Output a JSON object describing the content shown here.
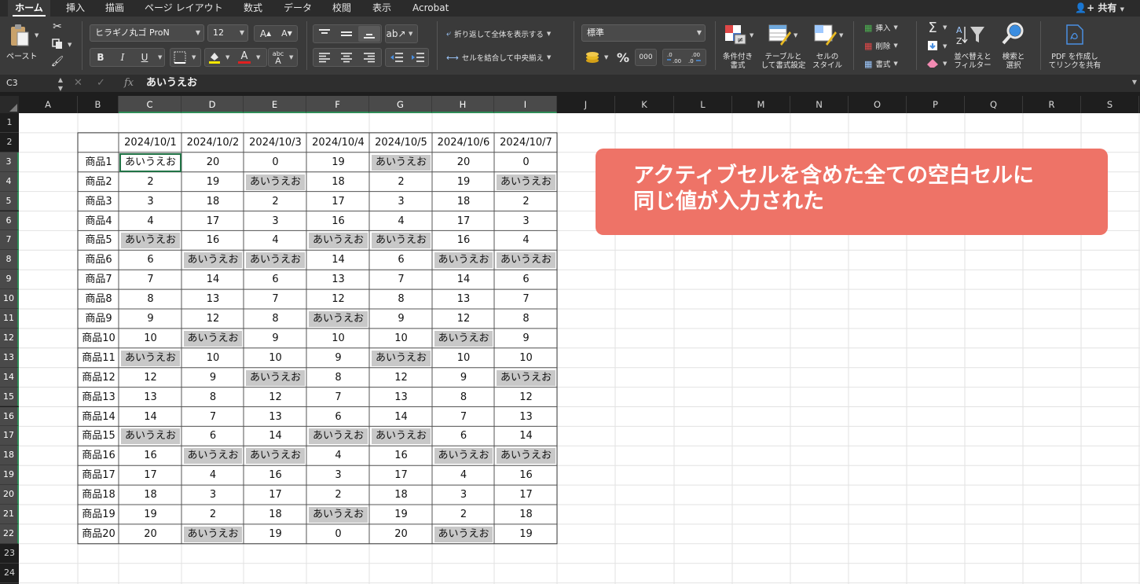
{
  "tabs": [
    "ホーム",
    "挿入",
    "描画",
    "ページ レイアウト",
    "数式",
    "データ",
    "校閲",
    "表示",
    "Acrobat"
  ],
  "share_label": "共有",
  "ribbon": {
    "paste": "ペースト",
    "font_name": "ヒラギノ丸ゴ ProN",
    "font_size": "12",
    "wrap_text": "折り返して全体を表示する",
    "merge_center": "セルを結合して中央揃え",
    "number_format": "標準",
    "percent": "%",
    "comma": "000",
    "conditional_format": [
      "条件付き",
      "書式"
    ],
    "format_as_table": [
      "テーブルと",
      "して書式設定"
    ],
    "cell_styles": [
      "セルの",
      "スタイル"
    ],
    "insert": "挿入",
    "delete": "削除",
    "format": "書式",
    "sort_filter": [
      "並べ替えと",
      "フィルター"
    ],
    "find_select": [
      "検索と",
      "選択"
    ],
    "pdf": [
      "PDF を作成し",
      "てリンクを共有"
    ],
    "bold": "B",
    "italic": "I",
    "underline": "U",
    "abc": "abc"
  },
  "formula_bar": {
    "name_box": "C3",
    "fx": "fx",
    "value": "あいうえお"
  },
  "columns": [
    "A",
    "B",
    "C",
    "D",
    "E",
    "F",
    "G",
    "H",
    "I",
    "J",
    "K",
    "L",
    "M",
    "N",
    "O",
    "P",
    "Q",
    "R",
    "S"
  ],
  "rows": [
    "1",
    "2",
    "3",
    "4",
    "5",
    "6",
    "7",
    "8",
    "9",
    "10",
    "11",
    "12",
    "13",
    "14",
    "15",
    "16",
    "17",
    "18",
    "19",
    "20",
    "21",
    "22",
    "23",
    "24"
  ],
  "selected_columns": [
    "C",
    "D",
    "E",
    "F",
    "G",
    "H",
    "I"
  ],
  "selected_rows": [
    "3",
    "4",
    "5",
    "6",
    "7",
    "8",
    "9",
    "10",
    "11",
    "12",
    "13",
    "14",
    "15",
    "16",
    "17",
    "18",
    "19",
    "20",
    "21",
    "22"
  ],
  "filler_text": "あいうえお",
  "table": {
    "dates": [
      "2024/10/1",
      "2024/10/2",
      "2024/10/3",
      "2024/10/4",
      "2024/10/5",
      "2024/10/6",
      "2024/10/7"
    ],
    "rows": [
      {
        "label": "商品1",
        "values": [
          "あいうえお",
          "20",
          "0",
          "19",
          "あいうえお",
          "20",
          "0"
        ]
      },
      {
        "label": "商品2",
        "values": [
          "2",
          "19",
          "あいうえお",
          "18",
          "2",
          "19",
          "あいうえお"
        ]
      },
      {
        "label": "商品3",
        "values": [
          "3",
          "18",
          "2",
          "17",
          "3",
          "18",
          "2"
        ]
      },
      {
        "label": "商品4",
        "values": [
          "4",
          "17",
          "3",
          "16",
          "4",
          "17",
          "3"
        ]
      },
      {
        "label": "商品5",
        "values": [
          "あいうえお",
          "16",
          "4",
          "あいうえお",
          "あいうえお",
          "16",
          "4"
        ]
      },
      {
        "label": "商品6",
        "values": [
          "6",
          "あいうえお",
          "あいうえお",
          "14",
          "6",
          "あいうえお",
          "あいうえお"
        ]
      },
      {
        "label": "商品7",
        "values": [
          "7",
          "14",
          "6",
          "13",
          "7",
          "14",
          "6"
        ]
      },
      {
        "label": "商品8",
        "values": [
          "8",
          "13",
          "7",
          "12",
          "8",
          "13",
          "7"
        ]
      },
      {
        "label": "商品9",
        "values": [
          "9",
          "12",
          "8",
          "あいうえお",
          "9",
          "12",
          "8"
        ]
      },
      {
        "label": "商品10",
        "values": [
          "10",
          "あいうえお",
          "9",
          "10",
          "10",
          "あいうえお",
          "9"
        ]
      },
      {
        "label": "商品11",
        "values": [
          "あいうえお",
          "10",
          "10",
          "9",
          "あいうえお",
          "10",
          "10"
        ]
      },
      {
        "label": "商品12",
        "values": [
          "12",
          "9",
          "あいうえお",
          "8",
          "12",
          "9",
          "あいうえお"
        ]
      },
      {
        "label": "商品13",
        "values": [
          "13",
          "8",
          "12",
          "7",
          "13",
          "8",
          "12"
        ]
      },
      {
        "label": "商品14",
        "values": [
          "14",
          "7",
          "13",
          "6",
          "14",
          "7",
          "13"
        ]
      },
      {
        "label": "商品15",
        "values": [
          "あいうえお",
          "6",
          "14",
          "あいうえお",
          "あいうえお",
          "6",
          "14"
        ]
      },
      {
        "label": "商品16",
        "values": [
          "16",
          "あいうえお",
          "あいうえお",
          "4",
          "16",
          "あいうえお",
          "あいうえお"
        ]
      },
      {
        "label": "商品17",
        "values": [
          "17",
          "4",
          "16",
          "3",
          "17",
          "4",
          "16"
        ]
      },
      {
        "label": "商品18",
        "values": [
          "18",
          "3",
          "17",
          "2",
          "18",
          "3",
          "17"
        ]
      },
      {
        "label": "商品19",
        "values": [
          "19",
          "2",
          "18",
          "あいうえお",
          "19",
          "2",
          "18"
        ]
      },
      {
        "label": "商品20",
        "values": [
          "20",
          "あいうえお",
          "19",
          "0",
          "20",
          "あいうえお",
          "19"
        ]
      }
    ]
  },
  "active_cell": "C3",
  "callout": {
    "line1": "アクティブセルを含めた全ての空白セルに",
    "line2": "同じ値が入力された",
    "color": "#ee7367"
  },
  "colors": {
    "ribbon_bg": "#3a3a3a",
    "tab_bg": "#2b2b2b",
    "header_bg": "#1e1e1e",
    "filled_cell": "#c8c8c8",
    "selection_accent": "#2e8b57"
  }
}
